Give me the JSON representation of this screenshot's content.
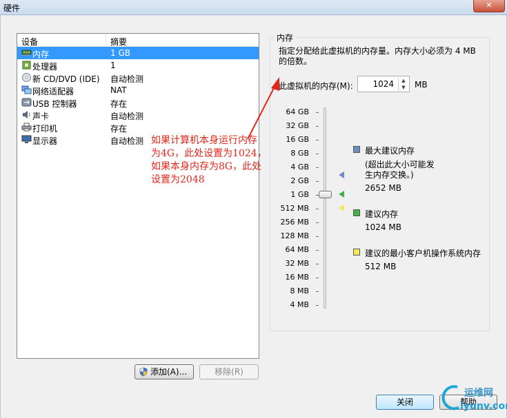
{
  "window": {
    "title": "硬件",
    "close_glyph": "✕"
  },
  "device_list": {
    "col_device": "设备",
    "col_summary": "摘要",
    "items": [
      {
        "name": "内存",
        "summary": "1 GB",
        "icon": "memory-icon",
        "selected": true
      },
      {
        "name": "处理器",
        "summary": "1",
        "icon": "processor-icon"
      },
      {
        "name": "新 CD/DVD (IDE)",
        "summary": "自动检测",
        "icon": "cd-dvd-icon"
      },
      {
        "name": "网络适配器",
        "summary": "NAT",
        "icon": "network-adapter-icon"
      },
      {
        "name": "USB 控制器",
        "summary": "存在",
        "icon": "usb-icon"
      },
      {
        "name": "声卡",
        "summary": "自动检测",
        "icon": "sound-card-icon"
      },
      {
        "name": "打印机",
        "summary": "存在",
        "icon": "printer-icon"
      },
      {
        "name": "显示器",
        "summary": "自动检测",
        "icon": "display-icon"
      }
    ]
  },
  "buttons": {
    "add": "添加(A)...",
    "remove": "移除(R)",
    "close": "关闭",
    "help": "帮助"
  },
  "memory": {
    "group_title": "内存",
    "description": "指定分配给此虚拟机的内存量。内存大小必须为 4 MB 的倍数。",
    "field_label": "此虚拟机的内存(M):",
    "value": "1024",
    "unit": "MB",
    "scale": [
      "64 GB",
      "32 GB",
      "16 GB",
      "8 GB",
      "4 GB",
      "2 GB",
      "1 GB",
      "512 MB",
      "256 MB",
      "128 MB",
      "64 MB",
      "32 MB",
      "16 MB",
      "8 MB",
      "4 MB"
    ],
    "legend": {
      "max_title": "最大建议内存",
      "max_note": "(超出此大小可能发生内存交换。)",
      "max_value": "2652 MB",
      "rec_title": "建议内存",
      "rec_value": "1024 MB",
      "min_title": "建议的最小客户机操作系统内存",
      "min_value": "512 MB"
    },
    "colors": {
      "max": "#6b8fc4",
      "recommended": "#43b14a",
      "min": "#f2ea5a"
    }
  },
  "annotation": {
    "lines": [
      "如果计算机本身运行内存",
      "为4G，此处设置为1024，",
      "如果本身内存为8G，此处",
      "设置为2048"
    ],
    "color": "#e0261b"
  },
  "watermark": {
    "cn": "运维网",
    "url": "iyunv.com"
  }
}
